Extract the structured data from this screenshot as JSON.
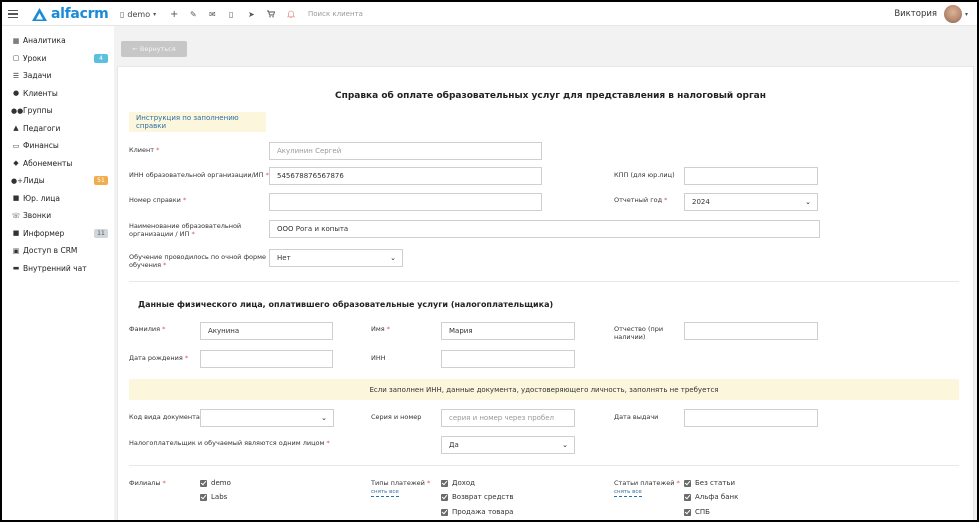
{
  "topbar": {
    "logo_text": "alfacrm",
    "branch": "demo",
    "search_placeholder": "Поиск клиента",
    "user_name": "Виктория"
  },
  "sidebar": {
    "items": [
      {
        "label": "Аналитика",
        "icon": "chart-icon"
      },
      {
        "label": "Уроки",
        "icon": "calendar-icon",
        "badge": "4",
        "badge_color": "#5bc0de"
      },
      {
        "label": "Задачи",
        "icon": "tasks-icon"
      },
      {
        "label": "Клиенты",
        "icon": "user-icon"
      },
      {
        "label": "Группы",
        "icon": "users-icon"
      },
      {
        "label": "Педагоги",
        "icon": "graduation-cap-icon"
      },
      {
        "label": "Финансы",
        "icon": "money-icon"
      },
      {
        "label": "Абонементы",
        "icon": "tag-icon"
      },
      {
        "label": "Лиды",
        "icon": "user-plus-icon",
        "badge": "51",
        "badge_color": "#f0ad4e"
      },
      {
        "label": "Юр. лица",
        "icon": "briefcase-icon"
      },
      {
        "label": "Звонки",
        "icon": "phone-icon"
      },
      {
        "label": "Информер",
        "icon": "informer-icon",
        "badge": "11",
        "badge_color": "#d0d6dc"
      },
      {
        "label": "Доступ в CRM",
        "icon": "lock-icon"
      },
      {
        "label": "Внутренний чат",
        "icon": "chat-icon"
      }
    ]
  },
  "page": {
    "back_label": "← Вернуться",
    "title": "Справка об оплате образовательных услуг для представления в налоговый орган",
    "hint": "Инструкция по заполнению справки"
  },
  "form": {
    "client_label": "Клиент",
    "client_value": "Акулинин Сергей",
    "inn_org_label": "ИНН образовательной организации/ИП",
    "inn_org_value": "545678876567876",
    "kpp_label": "КПП (для юр.лиц)",
    "kpp_value": "",
    "cert_no_label": "Номер справки",
    "cert_no_value": "",
    "year_label": "Отчетный год",
    "year_value": "2024",
    "org_name_label_1": "Наименование образовательной",
    "org_name_label_2": "организации / ИП",
    "org_name_value": "ООО Рога и копыта",
    "fulltime_label_1": "Обучение проводилось по очной форме",
    "fulltime_label_2": "обучения",
    "fulltime_value": "Нет"
  },
  "payer": {
    "section_title": "Данные физического лица, оплатившего образовательные услуги (налогоплательщика)",
    "lastname_label": "Фамилия",
    "lastname_value": "Акунина",
    "firstname_label": "Имя",
    "firstname_value": "Мария",
    "middlename_label_1": "Отчество (при",
    "middlename_label_2": "наличии)",
    "middlename_value": "",
    "birth_label": "Дата рождения",
    "birth_value": "",
    "inn_label": "ИНН",
    "inn_value": "",
    "notice": "Если заполнен ИНН, данные документа, удостоверяющего личность, заполнять не требуется",
    "doc_type_label": "Код вида документа",
    "doc_type_value": "",
    "series_label": "Серия и номер",
    "series_placeholder": "серия и номер через пробел",
    "issue_date_label": "Дата выдачи",
    "issue_date_value": "",
    "same_person_label": "Налогоплательщик и обучаемый являются одним лицом",
    "same_person_value": "Да"
  },
  "filters": {
    "branches_label": "Филиалы",
    "branches": [
      "demo",
      "Labs"
    ],
    "payment_types_label": "Типы платежей",
    "payment_types_link": "снять все",
    "payment_types": [
      "Доход",
      "Возврат средств",
      "Продажа товара"
    ],
    "payment_items_label": "Статьи платежей",
    "payment_items_link": "снять все",
    "payment_items": [
      "Без статьи",
      "Альфа банк",
      "СПБ"
    ]
  }
}
